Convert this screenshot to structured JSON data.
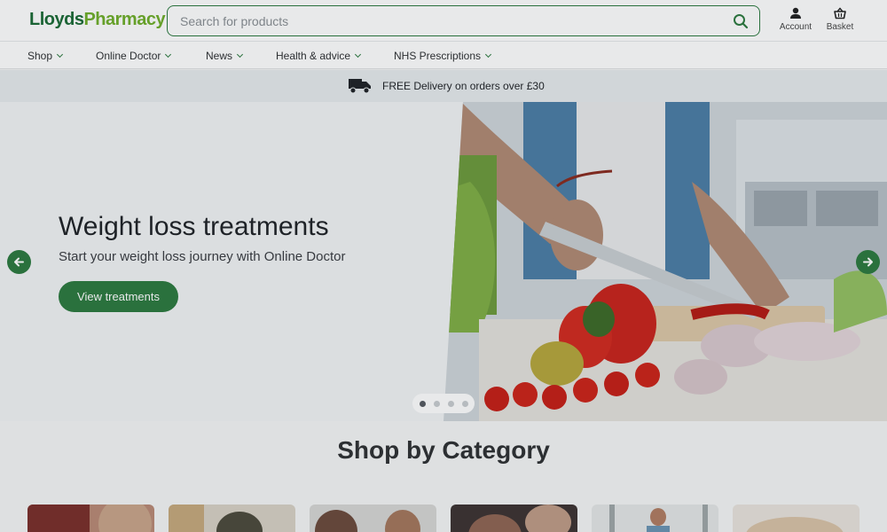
{
  "header": {
    "logo_part1": "Lloyds",
    "logo_part2": "Pharmacy",
    "search_placeholder": "Search for products",
    "search_icon": "search-icon",
    "account_label": "Account",
    "account_icon": "person-icon",
    "basket_label": "Basket",
    "basket_icon": "basket-icon"
  },
  "nav": {
    "items": [
      {
        "label": "Shop"
      },
      {
        "label": "Online Doctor"
      },
      {
        "label": "News"
      },
      {
        "label": "Health & advice"
      },
      {
        "label": "NHS Prescriptions"
      }
    ]
  },
  "delivery": {
    "icon": "truck-icon",
    "text": "FREE Delivery on orders over £30"
  },
  "hero": {
    "title": "Weight loss treatments",
    "subtitle": "Start your weight loss journey with Online Doctor",
    "button_label": "View treatments",
    "prev_icon": "arrow-left-icon",
    "next_icon": "arrow-right-icon",
    "slides_total": 4,
    "active_slide": 1
  },
  "categories": {
    "title": "Shop by Category"
  },
  "colors": {
    "brand_green": "#2c7a3f",
    "logo_dark_green": "#1a6a35",
    "logo_light_green": "#6fae2a"
  }
}
